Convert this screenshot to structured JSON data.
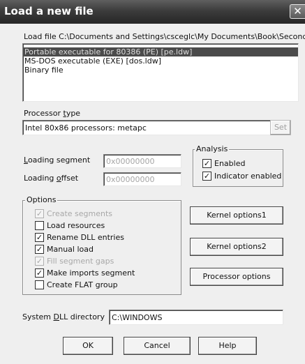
{
  "window": {
    "title": "Load a new file",
    "close_glyph": "✕"
  },
  "load_file": {
    "label": "Load file C:\\Documents and Settings\\csceglc\\My Documents\\Book\\Second"
  },
  "file_types": [
    {
      "label": "Portable executable for 80386 (PE) [pe.ldw]",
      "selected": true
    },
    {
      "label": "MS-DOS executable (EXE) [dos.ldw]",
      "selected": false
    },
    {
      "label": "Binary file",
      "selected": false
    }
  ],
  "processor": {
    "label_pre": "Processor ",
    "label_key": "t",
    "label_post": "ype",
    "value": "Intel 80x86 processors: metapc",
    "set_label": "Set"
  },
  "loading": {
    "segment_key": "L",
    "segment_rest": "oading segment",
    "segment_value": "0x00000000",
    "offset_pre": "Loading ",
    "offset_key": "o",
    "offset_post": "ffset",
    "offset_value": "0x00000000"
  },
  "analysis": {
    "legend": "Analysis",
    "items": [
      {
        "label": "Enabled",
        "checked": true
      },
      {
        "label": "Indicator enabled",
        "checked": true
      }
    ]
  },
  "options": {
    "legend": "Options",
    "items": [
      {
        "label": "Create segments",
        "checked": true,
        "disabled": true
      },
      {
        "label": "Load resources",
        "checked": false,
        "disabled": false
      },
      {
        "label": "Rename DLL entries",
        "checked": true,
        "disabled": false
      },
      {
        "label": "Manual load",
        "checked": true,
        "disabled": false
      },
      {
        "label": "Fill segment gaps",
        "checked": true,
        "disabled": true
      },
      {
        "label": "Make imports segment",
        "checked": true,
        "disabled": false
      },
      {
        "label": "Create FLAT group",
        "checked": false,
        "disabled": false
      }
    ]
  },
  "side_buttons": {
    "kernel1": "Kernel options1",
    "kernel2": "Kernel options2",
    "processor": "Processor options"
  },
  "system_dll": {
    "label_pre": "System ",
    "label_key": "D",
    "label_post": "LL directory",
    "value": "C:\\WINDOWS"
  },
  "footer": {
    "ok": "OK",
    "cancel": "Cancel",
    "help": "Help"
  }
}
